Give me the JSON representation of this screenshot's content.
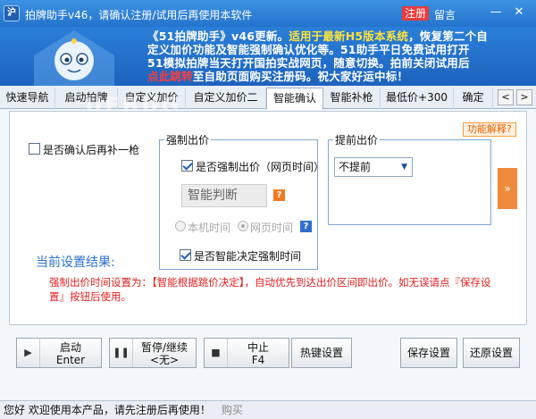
{
  "title_bar": {
    "app_icon": "沪",
    "title": "拍牌助手v46，请确认注册/试用后再使用本软件",
    "register": "注册",
    "message": "留言",
    "minimize": "—",
    "close": "✕"
  },
  "banner": {
    "line_parts": [
      {
        "text": "《51拍牌助手》v46更新。适用于最新H5版本系统，恢复第二个自",
        "style": "mix"
      },
      {
        "text": "定义加价功能及智能强制确认优化等。51助手平日免费试用打开",
        "style": "normal"
      },
      {
        "text": "51模拟拍牌当天打开国拍实战网页，随意切换。拍前关闭试用后",
        "style": "normal"
      },
      {
        "text": "至自助页面购买注册码。祝大家好运中标！",
        "style": "normal"
      }
    ],
    "prefix_hl": "《51拍牌助手》v46更新。",
    "line1_yellow": "适用于最新H5版本系统",
    "line1_rest": "，恢复第二个自",
    "line2": "定义加价功能及智能强制确认优化等。51助手平日免费试用打开",
    "line3": "51模拟拍牌当天打开国拍实战网页，随意切换。拍前关闭试用后",
    "line4_red": "点此跳转",
    "line4_rest": "至自助页面购买注册码。祝大家好运中标！"
  },
  "tabs": [
    {
      "label": "快速导航"
    },
    {
      "label": "启动拍牌"
    },
    {
      "label": "自定义加价"
    },
    {
      "label": "自定义加价二"
    },
    {
      "label": "智能确认"
    },
    {
      "label": "智能补枪"
    },
    {
      "label": "最低价+300"
    },
    {
      "label": "确定"
    }
  ],
  "active_tab": "智能确认",
  "watermark": "UEBUG",
  "help_button": "功能解释?",
  "confirm_again": {
    "label": "是否确认后再补一枪",
    "checked": false
  },
  "force_bid": {
    "group_title": "强制出价",
    "checkbox_label": "是否强制出价（网页时间）",
    "checked": true,
    "field_value": "智能判断",
    "radio_local": "本机时间",
    "radio_web": "网页时间",
    "smart_label": "是否智能决定强制时间",
    "smart_checked": true,
    "q": "?"
  },
  "advance_bid": {
    "group_title": "提前出价",
    "select_value": "不提前",
    "side_button": "»"
  },
  "result": {
    "label": "当前设置结果:",
    "text": "强制出价时间设置为：【智能根据跳价决定】，自动优先到达出价区间即出价。如无误请点『保存设置』按钮后使用。"
  },
  "buttons": {
    "start_label": "启动",
    "start_sub": "Enter",
    "pause_label": "暂停/继续",
    "pause_sub": "<无>",
    "stop_label": "中止",
    "stop_sub": "F4",
    "hotkey": "热键设置",
    "save": "保存设置",
    "restore": "还原设置"
  },
  "status": {
    "text": "您好 欢迎使用本产品，请先注册后再使用！",
    "buy": "购买"
  }
}
